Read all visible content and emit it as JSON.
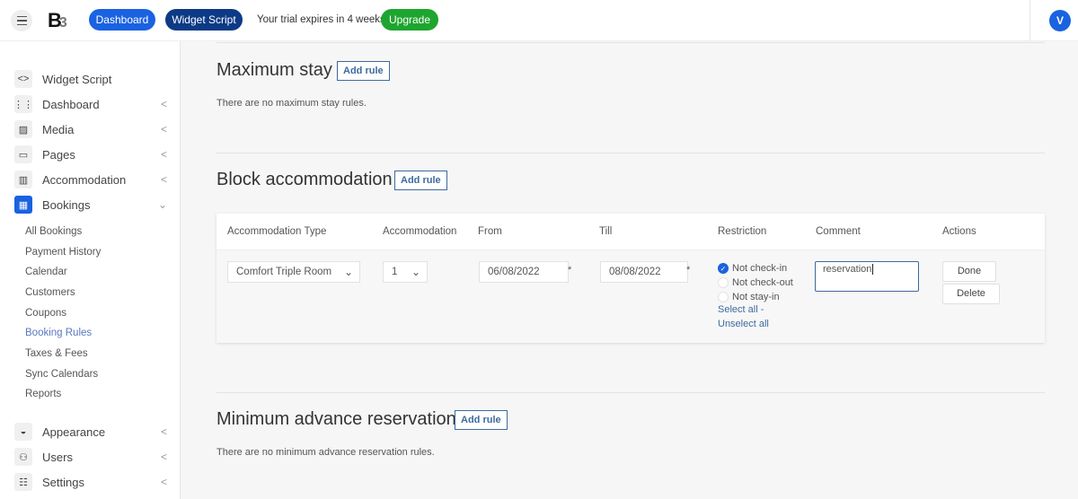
{
  "header": {
    "logo": "B3",
    "dashboard": "Dashboard",
    "widget_script": "Widget Script",
    "trial": "Your trial expires in 4 weeks",
    "upgrade": "Upgrade",
    "avatar": "V"
  },
  "sidebar": {
    "items": [
      {
        "label": "Widget Script",
        "icon": "code-icon"
      },
      {
        "label": "Dashboard",
        "icon": "grid-icon"
      },
      {
        "label": "Media",
        "icon": "image-icon"
      },
      {
        "label": "Pages",
        "icon": "page-icon"
      },
      {
        "label": "Accommodation",
        "icon": "building-icon"
      },
      {
        "label": "Bookings",
        "icon": "calendar-icon"
      }
    ],
    "bookings_sub": [
      "All Bookings",
      "Payment History",
      "Calendar",
      "Customers",
      "Coupons",
      "Booking Rules",
      "Taxes & Fees",
      "Sync Calendars",
      "Reports"
    ],
    "active_sub": "Booking Rules",
    "bottom": [
      {
        "label": "Appearance",
        "icon": "paint-bucket-icon"
      },
      {
        "label": "Users",
        "icon": "users-icon"
      },
      {
        "label": "Settings",
        "icon": "sliders-icon"
      }
    ]
  },
  "sections": {
    "max_stay": {
      "title": "Maximum stay",
      "add": "Add rule",
      "empty": "There are no maximum stay rules."
    },
    "block": {
      "title": "Block accommodation",
      "add": "Add rule",
      "columns": [
        "Accommodation Type",
        "Accommodation",
        "From",
        "Till",
        "Restriction",
        "Comment",
        "Actions"
      ],
      "row": {
        "type": "Comfort Triple Room",
        "accommodation": "1",
        "from": "06/08/2022",
        "till": "08/08/2022",
        "restrictions": [
          {
            "label": "Not check-in",
            "checked": true
          },
          {
            "label": "Not check-out",
            "checked": false
          },
          {
            "label": "Not stay-in",
            "checked": false
          }
        ],
        "select_all": "Select all -",
        "unselect_all": "Unselect all",
        "comment": "reservation",
        "done": "Done",
        "delete": "Delete",
        "required_mark": "*"
      }
    },
    "min_advance": {
      "title": "Minimum advance reservation",
      "add": "Add rule",
      "empty": "There are no minimum advance reservation rules."
    }
  },
  "colors": {
    "primary": "#1a62e0",
    "dark": "#0d3a86",
    "green": "#1ea52f",
    "link": "#3d6a9e"
  }
}
